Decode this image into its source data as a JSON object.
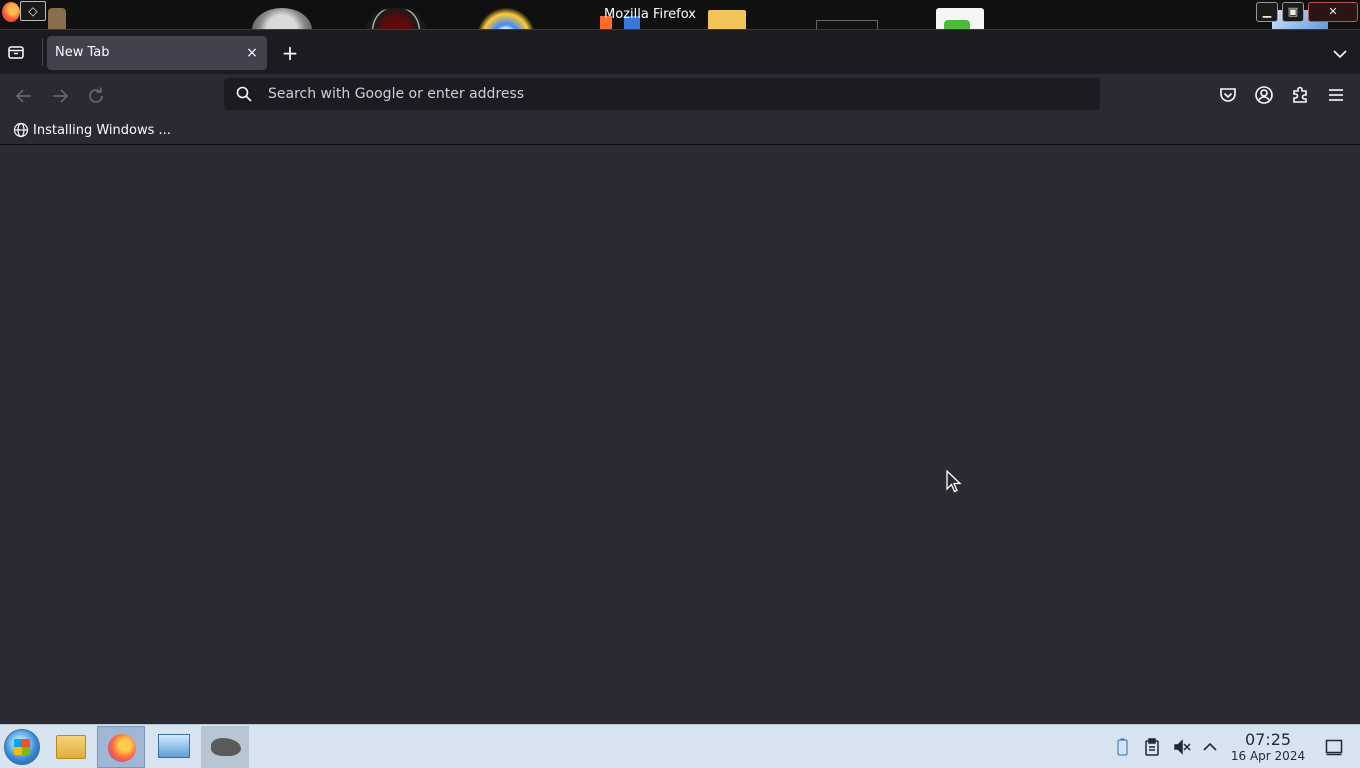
{
  "window": {
    "title": "Mozilla Firefox",
    "controls": {
      "minimize": "▁",
      "maximize": "▣",
      "close": "✕"
    }
  },
  "tabs": [
    {
      "title": "New Tab",
      "active": true
    }
  ],
  "tab_close_glyph": "×",
  "new_tab_glyph": "+",
  "urlbar": {
    "placeholder": "Search with Google or enter address",
    "value": ""
  },
  "bookmarks": [
    {
      "label": "Installing Windows ...",
      "icon": "globe-icon"
    }
  ],
  "taskbar": {
    "apps": [
      "start-menu",
      "file-manager",
      "firefox",
      "remote-desktop",
      "gimp"
    ],
    "active_app": "firefox",
    "clock": {
      "time": "07:25",
      "date": "16 Apr 2024"
    }
  },
  "colors": {
    "chrome_dark": "#1c1b22",
    "toolbar": "#2b2a33",
    "active_tab": "#42414d",
    "text": "#fbfbfe",
    "taskbar": "#d7e3ef"
  }
}
